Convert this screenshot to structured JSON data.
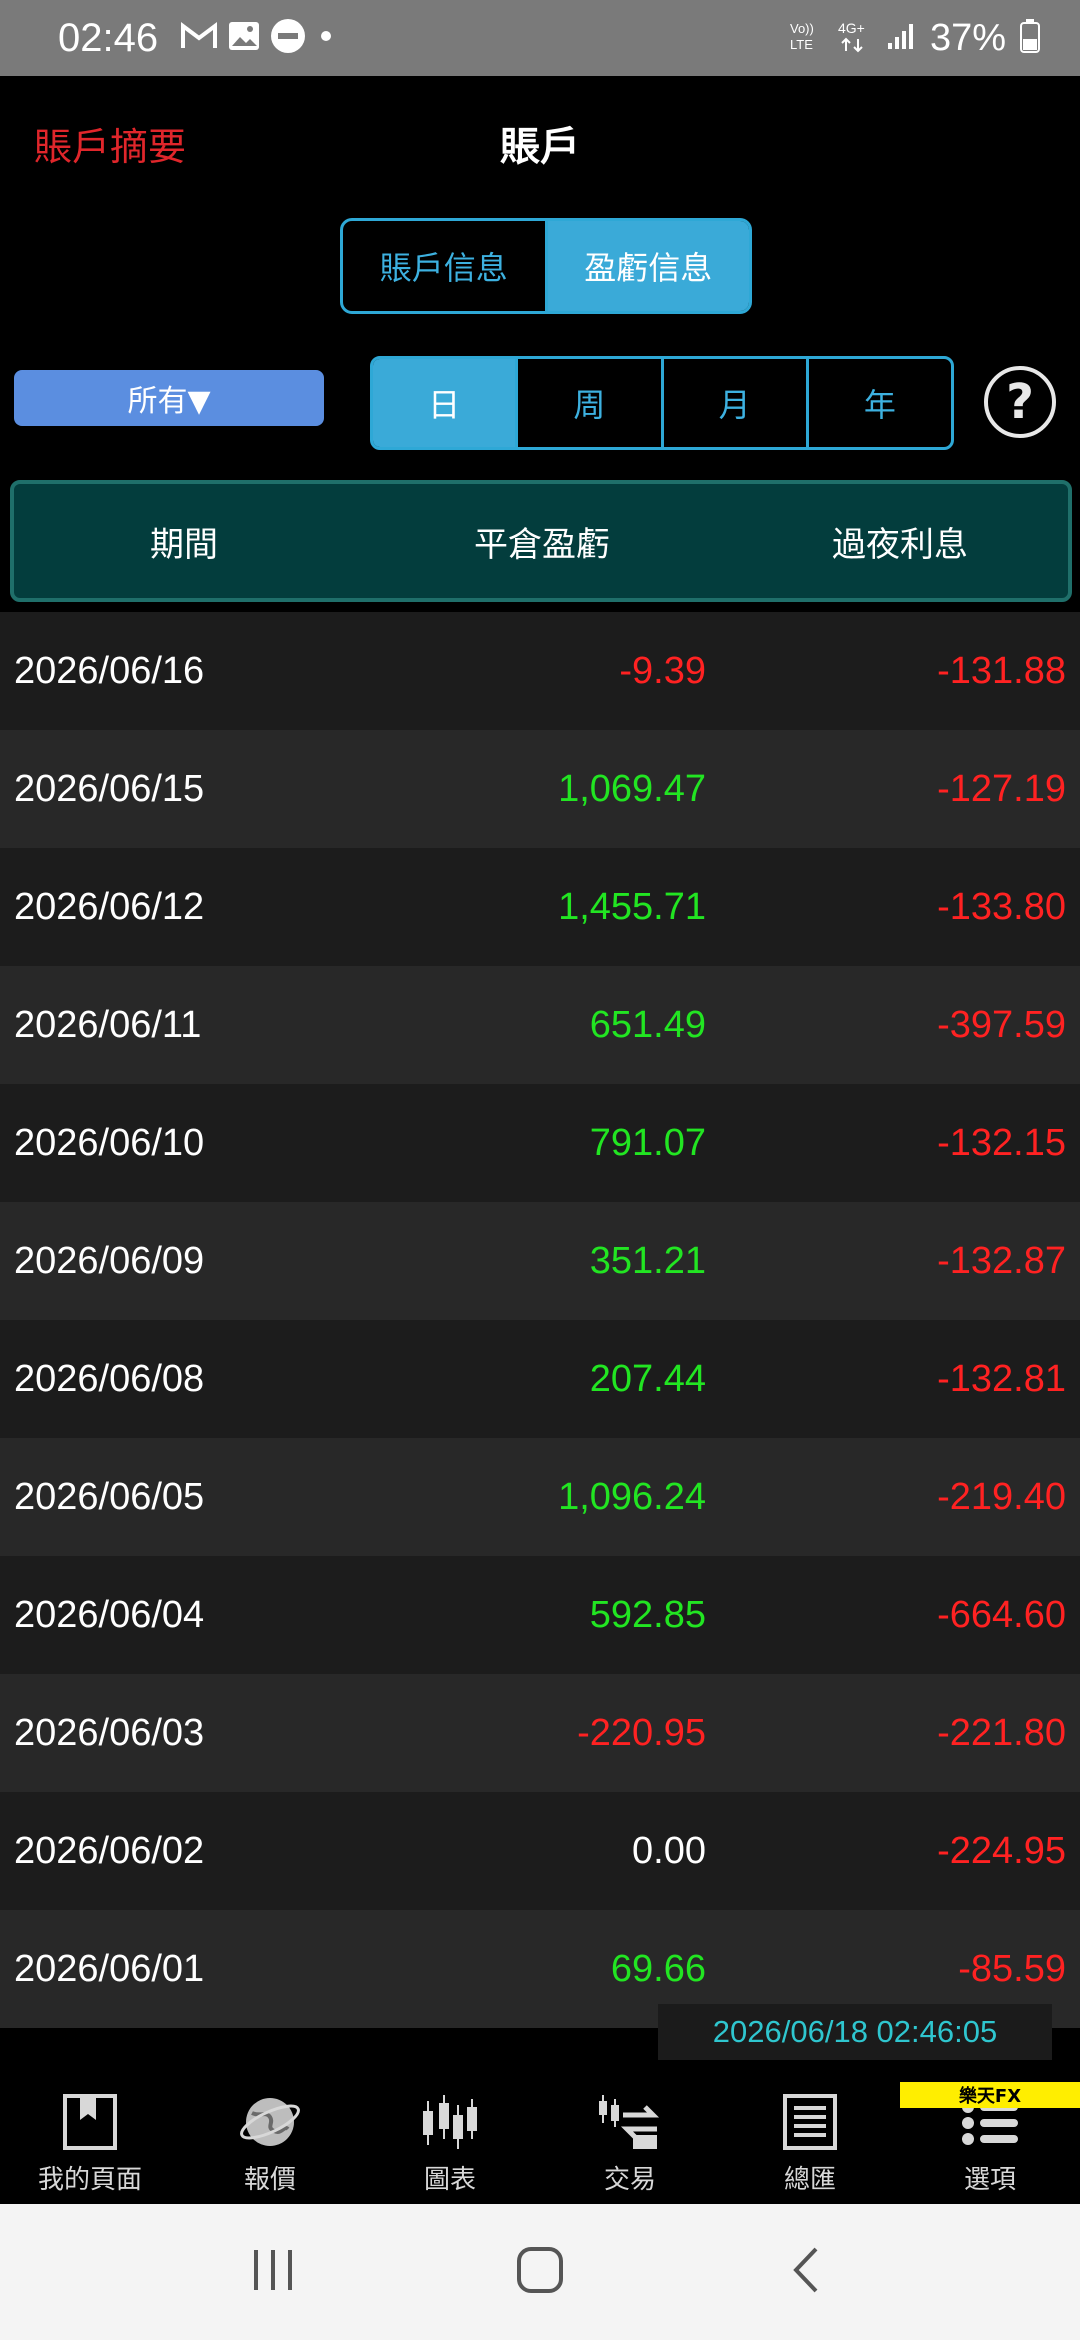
{
  "status_bar": {
    "time": "02:46",
    "battery": "37%",
    "network": "4G+",
    "volte": "Vo)) LTE"
  },
  "header": {
    "back_label": "賬戶摘要",
    "title": "賬戶"
  },
  "info_tabs": [
    {
      "label": "賬戶信息",
      "active": false
    },
    {
      "label": "盈虧信息",
      "active": true
    }
  ],
  "filter": {
    "label": "所有▼"
  },
  "period_tabs": [
    {
      "label": "日",
      "active": true
    },
    {
      "label": "周",
      "active": false
    },
    {
      "label": "月",
      "active": false
    },
    {
      "label": "年",
      "active": false
    }
  ],
  "help_label": "?",
  "table": {
    "headers": [
      "期間",
      "平倉盈虧",
      "過夜利息"
    ],
    "rows": [
      {
        "date": "2026/06/16",
        "pl": "-9.39",
        "overnight": "-131.88"
      },
      {
        "date": "2026/06/15",
        "pl": "1,069.47",
        "overnight": "-127.19"
      },
      {
        "date": "2026/06/12",
        "pl": "1,455.71",
        "overnight": "-133.80"
      },
      {
        "date": "2026/06/11",
        "pl": "651.49",
        "overnight": "-397.59"
      },
      {
        "date": "2026/06/10",
        "pl": "791.07",
        "overnight": "-132.15"
      },
      {
        "date": "2026/06/09",
        "pl": "351.21",
        "overnight": "-132.87"
      },
      {
        "date": "2026/06/08",
        "pl": "207.44",
        "overnight": "-132.81"
      },
      {
        "date": "2026/06/05",
        "pl": "1,096.24",
        "overnight": "-219.40"
      },
      {
        "date": "2026/06/04",
        "pl": "592.85",
        "overnight": "-664.60"
      },
      {
        "date": "2026/06/03",
        "pl": "-220.95",
        "overnight": "-221.80"
      },
      {
        "date": "2026/06/02",
        "pl": "0.00",
        "overnight": "-224.95"
      },
      {
        "date": "2026/06/01",
        "pl": "69.66",
        "overnight": "-85.59"
      }
    ]
  },
  "timestamp": "2026/06/18 02:46:05",
  "brand": "樂天FX",
  "bottom_nav": [
    {
      "label": "我的頁面",
      "icon": "bookmark-icon"
    },
    {
      "label": "報價",
      "icon": "globe-icon"
    },
    {
      "label": "圖表",
      "icon": "candlestick-icon"
    },
    {
      "label": "交易",
      "icon": "trade-icon"
    },
    {
      "label": "總匯",
      "icon": "list-document-icon"
    },
    {
      "label": "選項",
      "icon": "menu-list-icon"
    }
  ],
  "colors": {
    "positive": "#22e522",
    "negative": "#ff2222",
    "accent": "#3aaad8",
    "header_bg": "#033d3d"
  }
}
